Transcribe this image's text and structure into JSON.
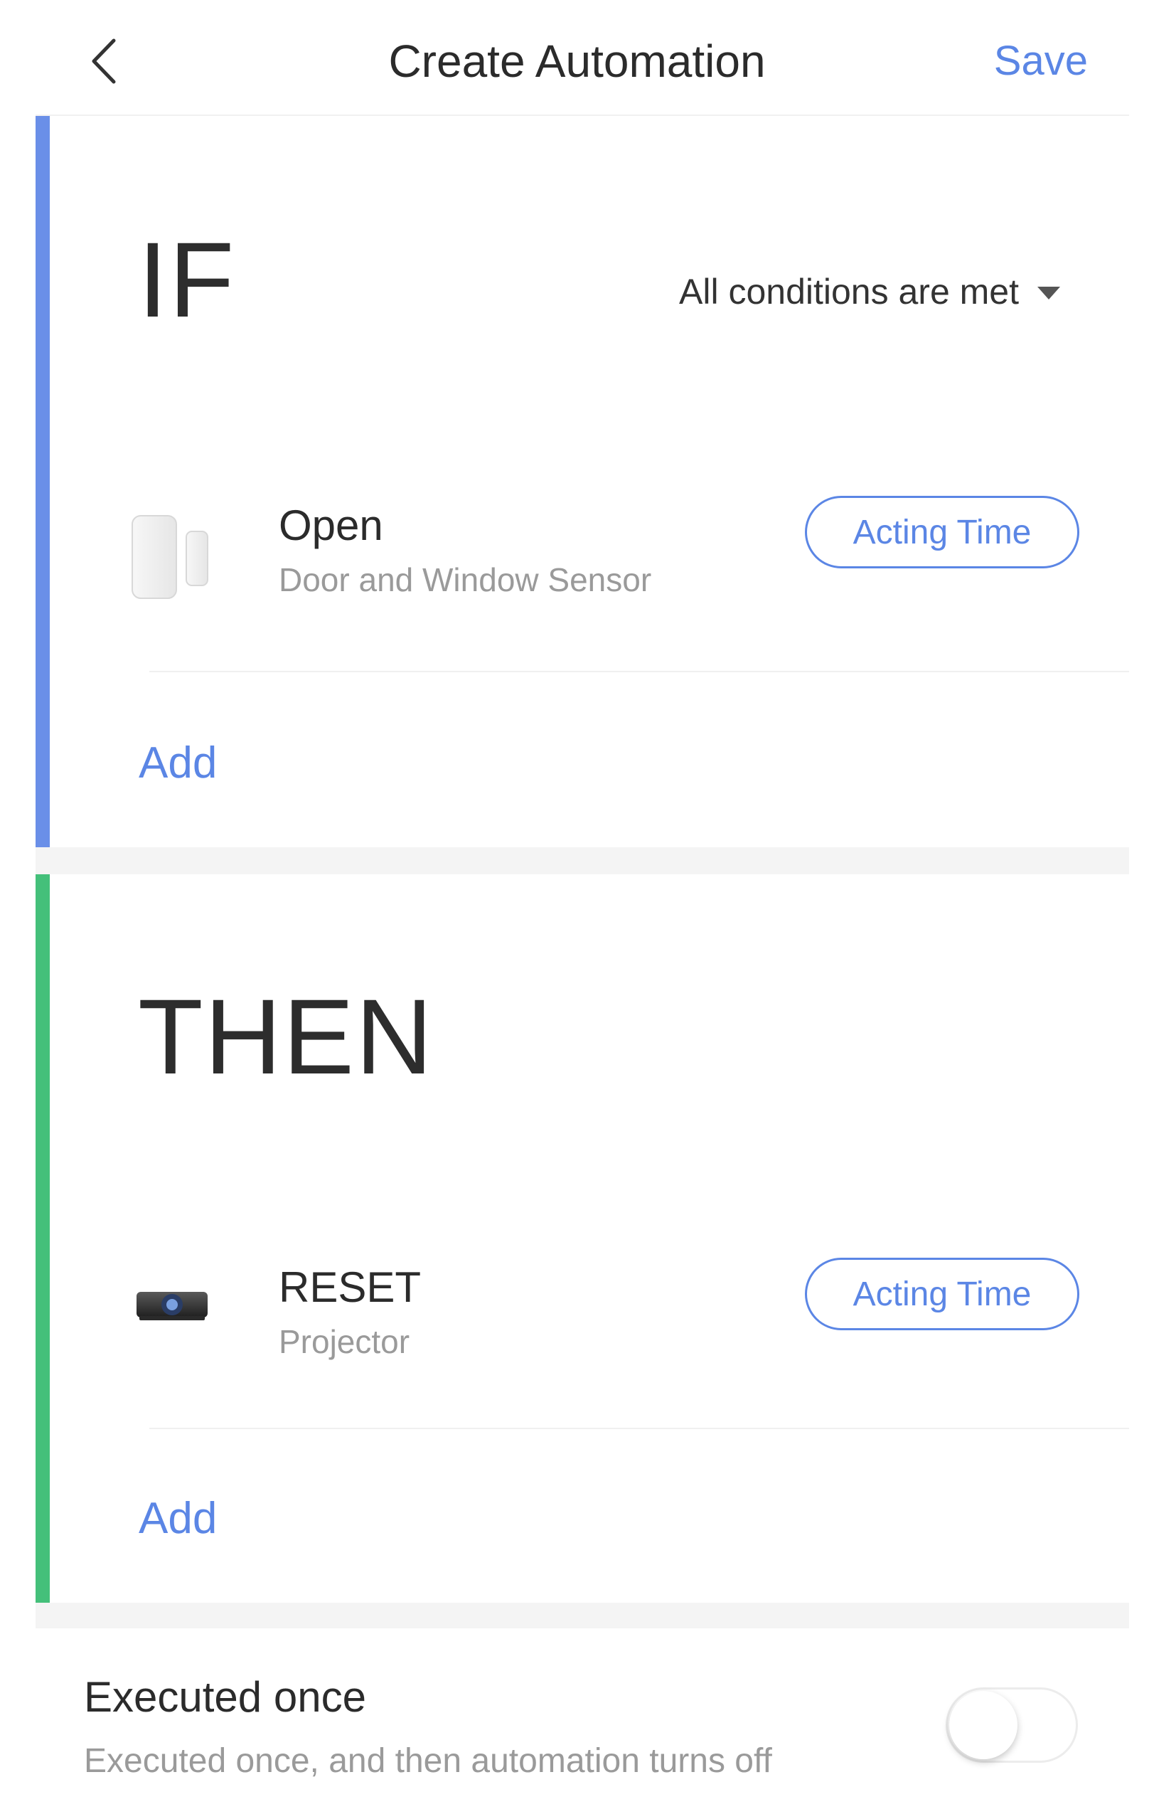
{
  "header": {
    "title": "Create Automation",
    "save_label": "Save",
    "back_icon": "chevron-left-icon"
  },
  "if_section": {
    "heading": "IF",
    "accent_color": "#6a8fe8",
    "condition_mode": "All conditions are met",
    "items": [
      {
        "title": "Open",
        "subtitle": "Door and Window Sensor",
        "icon": "door-window-sensor-icon",
        "action_label": "Acting Time"
      }
    ],
    "add_label": "Add"
  },
  "then_section": {
    "heading": "THEN",
    "accent_color": "#44c07a",
    "items": [
      {
        "title": "RESET",
        "subtitle": "Projector",
        "icon": "projector-icon",
        "action_label": "Acting Time"
      }
    ],
    "add_label": "Add"
  },
  "executed_once": {
    "title": "Executed once",
    "description": "Executed once, and then automation turns off",
    "enabled": false
  },
  "colors": {
    "accent_blue": "#5b86e5",
    "text_primary": "#2b2b2b",
    "text_secondary": "#9a9a9a",
    "section_gap": "#f4f4f4"
  }
}
